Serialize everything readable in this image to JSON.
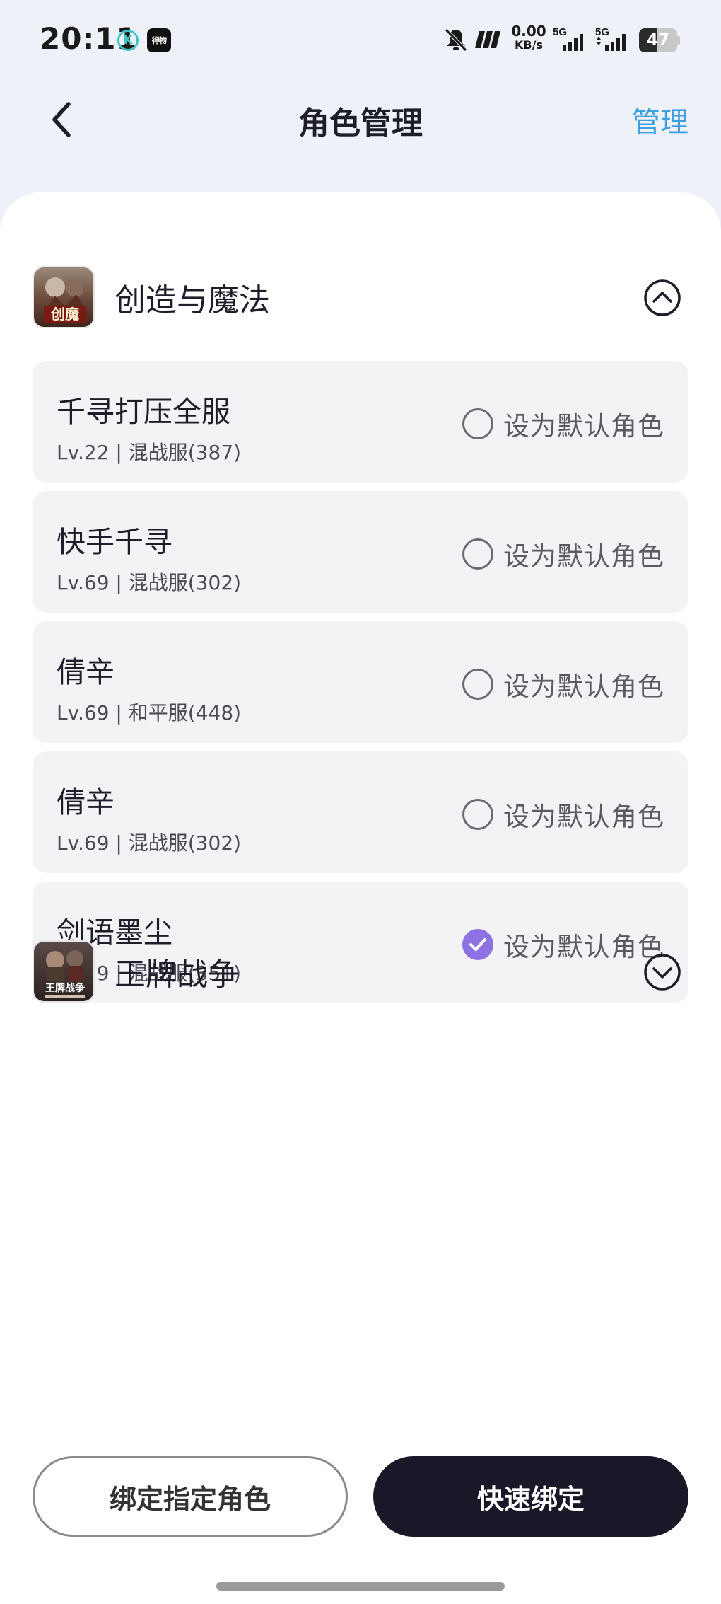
{
  "status_bar": {
    "time": "20:11",
    "k_badge": "K",
    "app_badge": "得物",
    "net_speed_value": "0.00",
    "net_speed_unit": "KB/s",
    "sim1_label": "5G",
    "sim2_label": "5G",
    "battery_level": "47",
    "battery_fraction": 0.47
  },
  "header": {
    "title": "角色管理",
    "manage_label": "管理",
    "back_icon": "chevron-left-icon"
  },
  "games": [
    {
      "name": "创造与魔法",
      "icon": "game-icon-creation-magic",
      "expanded": true,
      "toggle_icon": "chevron-up-circle-icon",
      "roles": [
        {
          "name": "千寻打压全服",
          "meta": "Lv.22 | 混战服(387)",
          "default_label": "设为默认角色",
          "is_default": false
        },
        {
          "name": "快手千寻",
          "meta": "Lv.69 | 混战服(302)",
          "default_label": "设为默认角色",
          "is_default": false
        },
        {
          "name": "倩辛",
          "meta": "Lv.69 | 和平服(448)",
          "default_label": "设为默认角色",
          "is_default": false
        },
        {
          "name": "倩辛",
          "meta": "Lv.69 | 混战服(302)",
          "default_label": "设为默认角色",
          "is_default": false
        },
        {
          "name": "剑语墨尘",
          "meta": "Lv.69 | 混战服(351)",
          "default_label": "设为默认角色",
          "is_default": true
        }
      ]
    },
    {
      "name": "王牌战争",
      "icon": "game-icon-ace-war",
      "expanded": false,
      "toggle_icon": "chevron-down-circle-icon",
      "icon_caption": "王牌战争"
    }
  ],
  "buttons": {
    "bind_specific": "绑定指定角色",
    "quick_bind": "快速绑定"
  },
  "colors": {
    "accent_blue": "#3f9fe3",
    "check_purple": "#8e72e4",
    "dark_button": "#191828",
    "page_bg": "#eef2f8",
    "card_bg": "#f3f3f5"
  }
}
